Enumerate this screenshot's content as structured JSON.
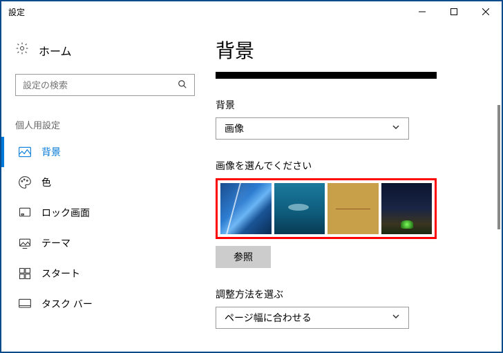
{
  "titlebar": {
    "title": "設定"
  },
  "sidebar": {
    "home_label": "ホーム",
    "search_placeholder": "設定の検索",
    "section_header": "個人用設定",
    "items": [
      {
        "label": "背景"
      },
      {
        "label": "色"
      },
      {
        "label": "ロック画面"
      },
      {
        "label": "テーマ"
      },
      {
        "label": "スタート"
      },
      {
        "label": "タスク バー"
      }
    ]
  },
  "main": {
    "page_title": "背景",
    "background_label": "背景",
    "background_dropdown_value": "画像",
    "choose_image_label": "画像を選んでください",
    "browse_button": "参照",
    "fit_label": "調整方法を選ぶ",
    "fit_dropdown_value": "ページ幅に合わせる"
  }
}
